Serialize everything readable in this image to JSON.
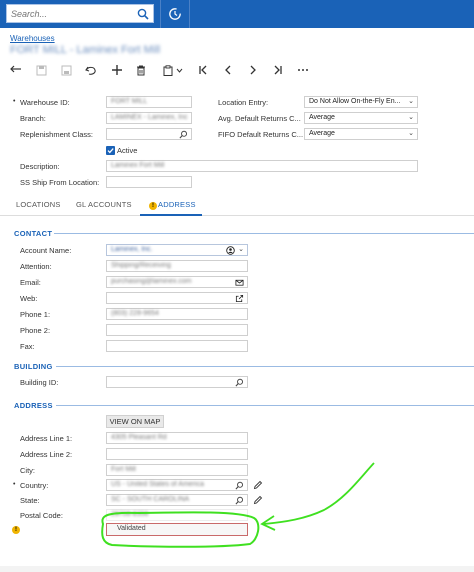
{
  "search": {
    "placeholder": "Search..."
  },
  "breadcrumb": "Warehouses",
  "screen_title": "FORT MILL - Laminex Fort Mill",
  "summary": {
    "warehouse_id_label": "Warehouse ID:",
    "warehouse_id_value": "FORT MILL",
    "branch_label": "Branch:",
    "branch_value": "LAMINEX - Laminex, Inc",
    "replenishment_label": "Replenishment Class:",
    "active_label": "Active",
    "description_label": "Description:",
    "description_value": "Laminex Fort Mill",
    "ship_from_label": "SS Ship From Location:",
    "location_entry_label": "Location Entry:",
    "location_entry_value": "Do Not Allow On-the-Fly En...",
    "avg_returns_label": "Avg. Default Returns C...",
    "avg_returns_value": "Average",
    "fifo_returns_label": "FIFO Default Returns C...",
    "fifo_returns_value": "Average"
  },
  "tabs": [
    {
      "label": "LOCATIONS"
    },
    {
      "label": "GL ACCOUNTS"
    },
    {
      "label": "ADDRESS"
    }
  ],
  "contact": {
    "section": "CONTACT",
    "account_name_label": "Account Name:",
    "account_name_value": "Laminex, Inc.",
    "attention_label": "Attention:",
    "attention_value": "Shipping/Receiving",
    "email_label": "Email:",
    "email_value": "purchasing@laminex.com",
    "web_label": "Web:",
    "phone1_label": "Phone 1:",
    "phone1_value": "(803) 228-9654",
    "phone2_label": "Phone 2:",
    "fax_label": "Fax:"
  },
  "building": {
    "section": "BUILDING",
    "building_id_label": "Building ID:"
  },
  "address": {
    "section": "ADDRESS",
    "view_map": "VIEW ON MAP",
    "line1_label": "Address Line 1:",
    "line1_value": "4305 Pleasant Rd",
    "line2_label": "Address Line 2:",
    "city_label": "City:",
    "city_value": "Fort Mill",
    "country_label": "Country:",
    "country_value": "US - United States of America",
    "state_label": "State:",
    "state_value": "SC - SOUTH CAROLINA",
    "postal_label": "Postal Code:",
    "postal_value": "29708-8356",
    "validated_label": "Validated"
  },
  "colors": {
    "header_blue": "#1a62b7",
    "annotation_green": "#3fe020",
    "warning_yellow": "#f0b400"
  }
}
